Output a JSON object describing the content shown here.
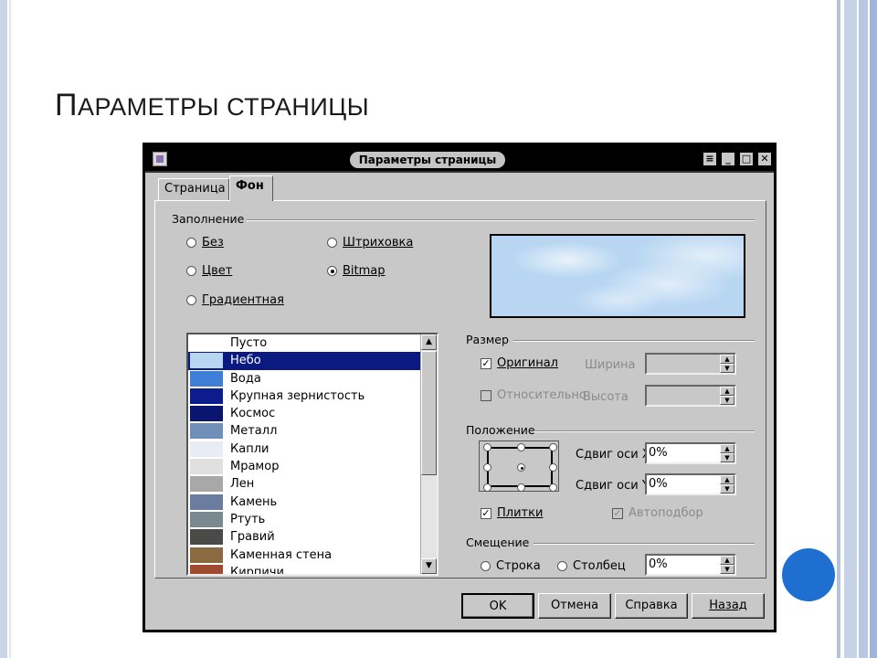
{
  "slide": {
    "title_first": "П",
    "title_rest": "АРАМЕТРЫ СТРАНИЦЫ"
  },
  "dialog": {
    "title": "Параметры страницы",
    "tabs": [
      {
        "label": "Страница"
      },
      {
        "label": "Фон"
      }
    ],
    "fill": {
      "group_label": "Заполнение",
      "options": [
        {
          "label": "Без",
          "checked": false
        },
        {
          "label": "Штриховка",
          "checked": false
        },
        {
          "label": "Цвет",
          "checked": false
        },
        {
          "label": "Bitmap",
          "checked": true
        },
        {
          "label": "Градиентная",
          "checked": false
        }
      ]
    },
    "bitmap_list": {
      "items": [
        {
          "label": "Пусто",
          "swatch": "#ffffff"
        },
        {
          "label": "Небо",
          "swatch": "#b8d6f2",
          "selected": true
        },
        {
          "label": "Вода",
          "swatch": "#3f7fd8"
        },
        {
          "label": "Крупная зернистость",
          "swatch": "#0b1d8c"
        },
        {
          "label": "Космос",
          "swatch": "#0a1570"
        },
        {
          "label": "Металл",
          "swatch": "#6f8fb8"
        },
        {
          "label": "Капли",
          "swatch": "#e8ecf4"
        },
        {
          "label": "Мрамор",
          "swatch": "#e0e0e0"
        },
        {
          "label": "Лен",
          "swatch": "#a8a8a8"
        },
        {
          "label": "Камень",
          "swatch": "#6a7ca0"
        },
        {
          "label": "Ртуть",
          "swatch": "#7a8890"
        },
        {
          "label": "Гравий",
          "swatch": "#4a4a48"
        },
        {
          "label": "Каменная стена",
          "swatch": "#8a6a40"
        },
        {
          "label": "Кирпичи",
          "swatch": "#a04a30"
        }
      ]
    },
    "size": {
      "group_label": "Размер",
      "original_label": "Оригинал",
      "original_checked": true,
      "relative_label": "Относительно",
      "width_label": "Ширина",
      "height_label": "Высота"
    },
    "position": {
      "group_label": "Положение",
      "offset_x_label": "Сдвиг оси X",
      "offset_x_value": "0%",
      "offset_y_label": "Сдвиг оси Y",
      "offset_y_value": "0%",
      "tile_label": "Плитки",
      "tile_checked": true,
      "autofit_label": "Автоподбор",
      "autofit_checked": true
    },
    "offset": {
      "group_label": "Смещение",
      "row_label": "Строка",
      "column_label": "Столбец",
      "value": "0%"
    },
    "buttons": {
      "ok": "OK",
      "cancel": "Отмена",
      "help": "Справка",
      "back": "Назад"
    }
  }
}
